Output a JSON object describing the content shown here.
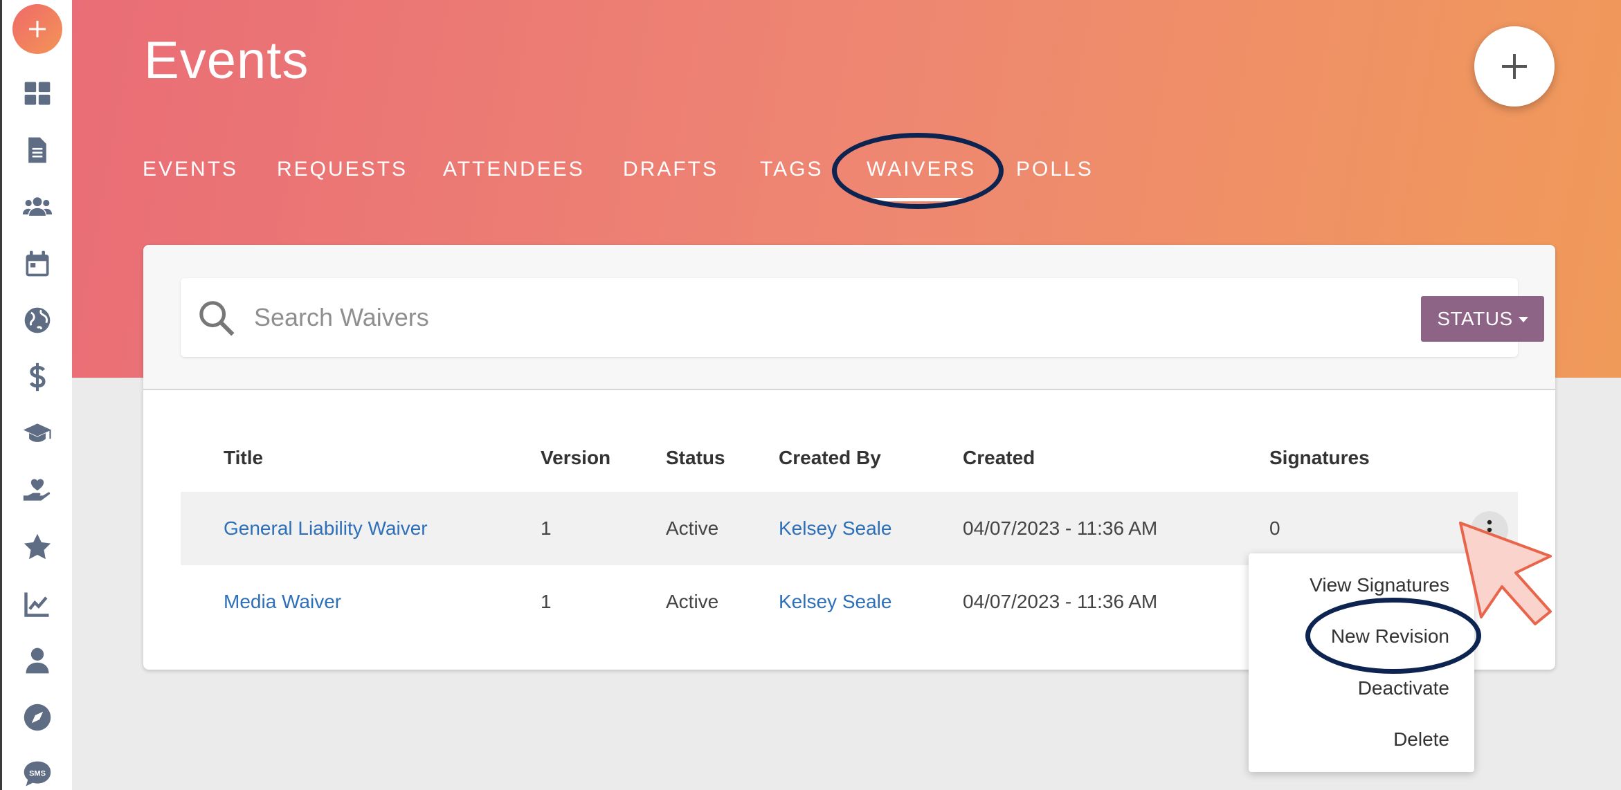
{
  "header": {
    "title": "Events",
    "add_label": "+"
  },
  "tabs": [
    {
      "label": "EVENTS"
    },
    {
      "label": "REQUESTS"
    },
    {
      "label": "ATTENDEES"
    },
    {
      "label": "DRAFTS"
    },
    {
      "label": "TAGS"
    },
    {
      "label": "WAIVERS",
      "active": true
    },
    {
      "label": "POLLS"
    }
  ],
  "sidebar": {
    "add_label": "+",
    "items": [
      {
        "icon": "dashboard-icon"
      },
      {
        "icon": "document-icon"
      },
      {
        "icon": "users-icon"
      },
      {
        "icon": "calendar-icon"
      },
      {
        "icon": "globe-icon"
      },
      {
        "icon": "dollar-icon"
      },
      {
        "icon": "graduation-cap-icon"
      },
      {
        "icon": "hand-heart-icon"
      },
      {
        "icon": "star-icon"
      },
      {
        "icon": "chart-line-icon"
      },
      {
        "icon": "user-icon"
      },
      {
        "icon": "compass-icon"
      },
      {
        "icon": "sms-icon",
        "label": "SMS"
      }
    ]
  },
  "search": {
    "placeholder": "Search Waivers",
    "status_label": "STATUS"
  },
  "table": {
    "columns": [
      "Title",
      "Version",
      "Status",
      "Created By",
      "Created",
      "Signatures"
    ],
    "rows": [
      {
        "title": "General Liability Waiver",
        "version": "1",
        "status": "Active",
        "created_by": "Kelsey Seale",
        "created": "04/07/2023 - 11:36 AM",
        "signatures": "0"
      },
      {
        "title": "Media Waiver",
        "version": "1",
        "status": "Active",
        "created_by": "Kelsey Seale",
        "created": "04/07/2023 - 11:36 AM",
        "signatures": ""
      }
    ]
  },
  "menu": {
    "items": [
      "View Signatures",
      "New Revision",
      "Deactivate",
      "Delete"
    ]
  },
  "colors": {
    "header_start": "#e96d76",
    "header_end": "#f09a5a",
    "status_button": "#8d6386",
    "link": "#2d6fb8",
    "annotation": "#0d2350"
  }
}
